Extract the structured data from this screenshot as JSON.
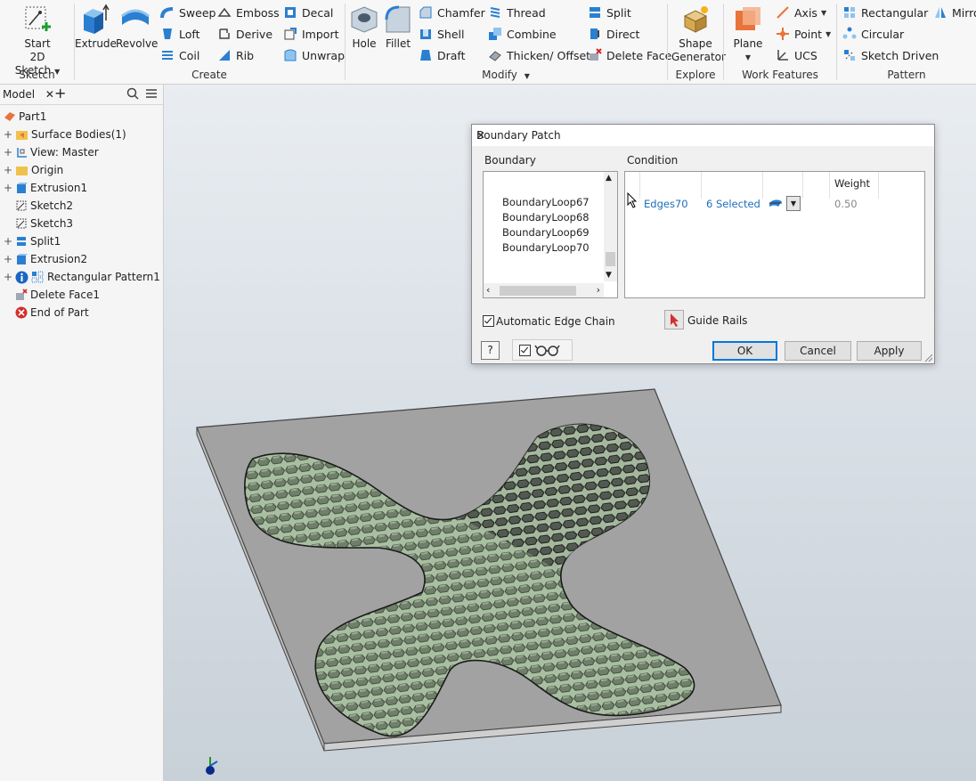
{
  "ribbon": {
    "sketch": {
      "start_label_1": "Start",
      "start_label_2": "2D Sketch",
      "group": "Sketch"
    },
    "create": {
      "extrude": "Extrude",
      "revolve": "Revolve",
      "sweep": "Sweep",
      "loft": "Loft",
      "coil": "Coil",
      "emboss": "Emboss",
      "derive": "Derive",
      "rib": "Rib",
      "decal": "Decal",
      "import": "Import",
      "unwrap": "Unwrap",
      "group": "Create"
    },
    "modify": {
      "hole": "Hole",
      "fillet": "Fillet",
      "chamfer": "Chamfer",
      "shell": "Shell",
      "draft": "Draft",
      "thread": "Thread",
      "combine": "Combine",
      "thicken": "Thicken/ Offset",
      "split": "Split",
      "direct": "Direct",
      "delete_face": "Delete Face",
      "group": "Modify"
    },
    "explore": {
      "shape_1": "Shape",
      "shape_2": "Generator",
      "group": "Explore"
    },
    "work_features": {
      "plane": "Plane",
      "axis": "Axis",
      "point": "Point",
      "ucs": "UCS",
      "group": "Work Features"
    },
    "pattern": {
      "rectangular": "Rectangular",
      "circular": "Circular",
      "sketch_driven": "Sketch Driven",
      "mirror": "Mirro",
      "group": "Pattern"
    }
  },
  "browser": {
    "tab": "Model",
    "items": [
      {
        "label": "Part1"
      },
      {
        "label": "Surface Bodies(1)"
      },
      {
        "label": "View: Master"
      },
      {
        "label": "Origin"
      },
      {
        "label": "Extrusion1"
      },
      {
        "label": "Sketch2"
      },
      {
        "label": "Sketch3"
      },
      {
        "label": "Split1"
      },
      {
        "label": "Extrusion2"
      },
      {
        "label": "Rectangular Pattern1"
      },
      {
        "label": "Delete Face1"
      },
      {
        "label": "End of Part"
      }
    ]
  },
  "dialog": {
    "title": "Boundary Patch",
    "boundary_label": "Boundary",
    "condition_label": "Condition",
    "loops": [
      "BoundaryLoop67",
      "BoundaryLoop68",
      "BoundaryLoop69",
      "BoundaryLoop70"
    ],
    "weight_header": "Weight",
    "condition_row": {
      "edges": "Edges70",
      "selected": "6 Selected",
      "weight": "0.50"
    },
    "auto_edge_chain": "Automatic Edge Chain",
    "guide_rails": "Guide Rails",
    "ok": "OK",
    "cancel": "Cancel",
    "apply": "Apply",
    "help": "?"
  },
  "colors": {
    "accent": "#0078d7",
    "link": "#1d6fb8",
    "plate": "#9a9a9a",
    "patch": "#b7ccb0"
  }
}
